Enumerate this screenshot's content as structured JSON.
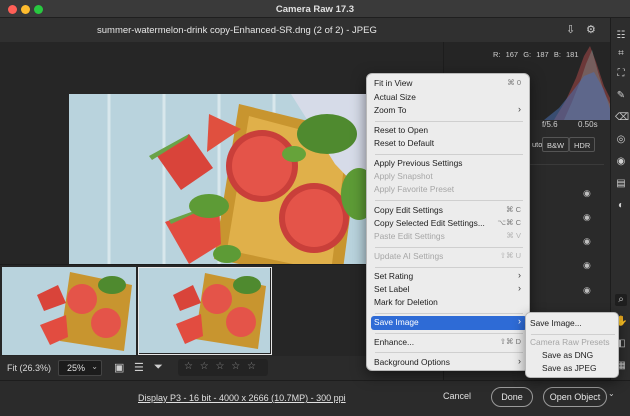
{
  "window": {
    "title": "Camera Raw 17.3"
  },
  "file": {
    "title": "summer-watermelon-drink copy-Enhanced-SR.dng (2 of 2)  -  JPEG"
  },
  "histogram": {
    "r": "R: 167",
    "g": "G: 187",
    "b": "B: 181"
  },
  "exif": {
    "aperture": "f/5.6",
    "shutter": "0.50s"
  },
  "profile_buttons": {
    "auto": "uto",
    "bw": "B&W",
    "hdr": "HDR"
  },
  "toolbar": {
    "zoom_fit": "Fit (26.3%)",
    "zoom_value": "25%",
    "stars": "☆ ☆ ☆ ☆ ☆"
  },
  "footer": {
    "display_info": "Display P3 - 16 bit - 4000 x 2666 (10.7MP) - 300 ppi",
    "cancel": "Cancel",
    "done": "Done",
    "open_object": "Open Object"
  },
  "context_menu": {
    "fit_in_view": "Fit in View",
    "fit_in_view_sc": "⌘ 0",
    "actual_size": "Actual Size",
    "zoom_to": "Zoom To",
    "reset_to_open": "Reset to Open",
    "reset_to_default": "Reset to Default",
    "apply_previous": "Apply Previous Settings",
    "apply_snapshot": "Apply Snapshot",
    "apply_favorite": "Apply Favorite Preset",
    "copy_edit": "Copy Edit Settings",
    "copy_edit_sc": "⌘ C",
    "copy_selected": "Copy Selected Edit Settings...",
    "copy_selected_sc": "⌥⌘ C",
    "paste_edit": "Paste Edit Settings",
    "paste_edit_sc": "⌘ V",
    "update_ai": "Update AI Settings",
    "update_ai_sc": "⇧⌘ U",
    "set_rating": "Set Rating",
    "set_label": "Set Label",
    "mark_deletion": "Mark for Deletion",
    "save_image": "Save Image",
    "enhance": "Enhance...",
    "enhance_sc": "⇧⌘ D",
    "background_options": "Background Options"
  },
  "save_submenu": {
    "save_image": "Save Image...",
    "header": "Camera Raw Presets",
    "save_dng": "Save as DNG",
    "save_jpeg": "Save as JPEG"
  },
  "colors": {
    "highlight": "#2e6bd6",
    "menu_bg": "#ececec",
    "background": "#2b2b2b"
  }
}
